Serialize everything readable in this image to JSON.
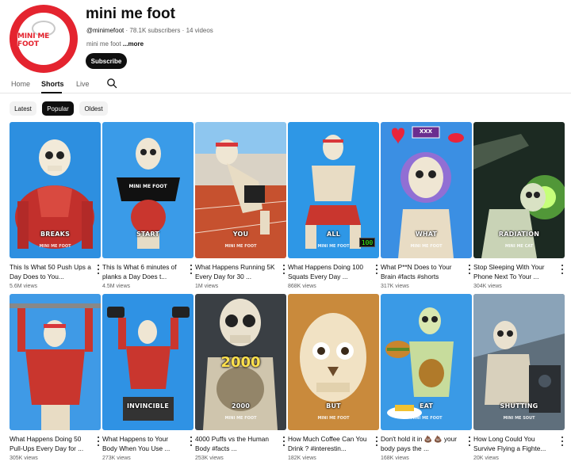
{
  "channel": {
    "avatar_text": "MINI ME FOOT",
    "name": "mini me foot",
    "handle": "@minimefoot",
    "subscribers": "78.1K subscribers",
    "videos": "14 videos",
    "separator": "·",
    "description": "mini me foot ",
    "more": "...more",
    "subscribe_label": "Subscribe"
  },
  "tabs": [
    {
      "label": "Home",
      "active": false
    },
    {
      "label": "Shorts",
      "active": true
    },
    {
      "label": "Live",
      "active": false
    }
  ],
  "search_icon": "search-icon",
  "filters": [
    {
      "label": "Latest",
      "active": false
    },
    {
      "label": "Popular",
      "active": true
    },
    {
      "label": "Oldest",
      "active": false
    }
  ],
  "shorts": [
    {
      "title": "This Is What 50 Push Ups a Day Does to You...",
      "views": "5.6M views",
      "caption": "BREAKS",
      "brand": "MINI ME FOOT"
    },
    {
      "title": "This Is What 6 minutes of planks a Day Does t...",
      "views": "4.5M views",
      "caption": "START",
      "shirt": "MINI ME FOOT"
    },
    {
      "title": "What Happens Running 5K Every Day for 30 ...",
      "views": "1M views",
      "caption": "YOU",
      "brand": "MINI ME FOOT"
    },
    {
      "title": "What Happens Doing 100 Squats Every Day ...",
      "views": "868K views",
      "caption": "ALL",
      "brand": "MINI ME FOOT",
      "counter": "100"
    },
    {
      "title": "What P**N Does to Your Brain  #facts #shorts",
      "views": "317K views",
      "caption": "WHAT",
      "brand": "MINI ME FOOT",
      "sign": "XXX"
    },
    {
      "title": "Stop Sleeping With Your Phone Next To Your ...",
      "views": "304K views",
      "caption": "RADIATION",
      "brand": "MINI ME CAT"
    },
    {
      "title": "What Happens Doing 50 Pull-Ups Every Day for ...",
      "views": "305K views",
      "caption": "",
      "brand": ""
    },
    {
      "title": "What Happens to Your Body When You Use ...",
      "views": "273K views",
      "caption": "INVINCIBLE",
      "brand": ""
    },
    {
      "title": "4000 Puffs vs the Human Body  #facts ...",
      "views": "253K views",
      "caption": "2000",
      "overlay": "2000",
      "brand": "MINI ME FOOT"
    },
    {
      "title": "How Much Coffee Can You Drink ? #interestin...",
      "views": "182K views",
      "caption": "BUT",
      "brand": "MINI ME FOOT"
    },
    {
      "title": "Don't hold it in 💩 💩 your body pays the ...",
      "views": "168K views",
      "caption": "EAT",
      "brand": "MINI ME FOOT"
    },
    {
      "title": "How Long Could You Survive Flying a Fighte...",
      "views": "20K views",
      "caption": "SHUTTING",
      "brand": "MINI ME SOUT"
    }
  ],
  "colors": {
    "accent": "#e4242f",
    "text": "#0f0f0f",
    "muted": "#606060",
    "chip_bg": "#f2f2f2"
  }
}
